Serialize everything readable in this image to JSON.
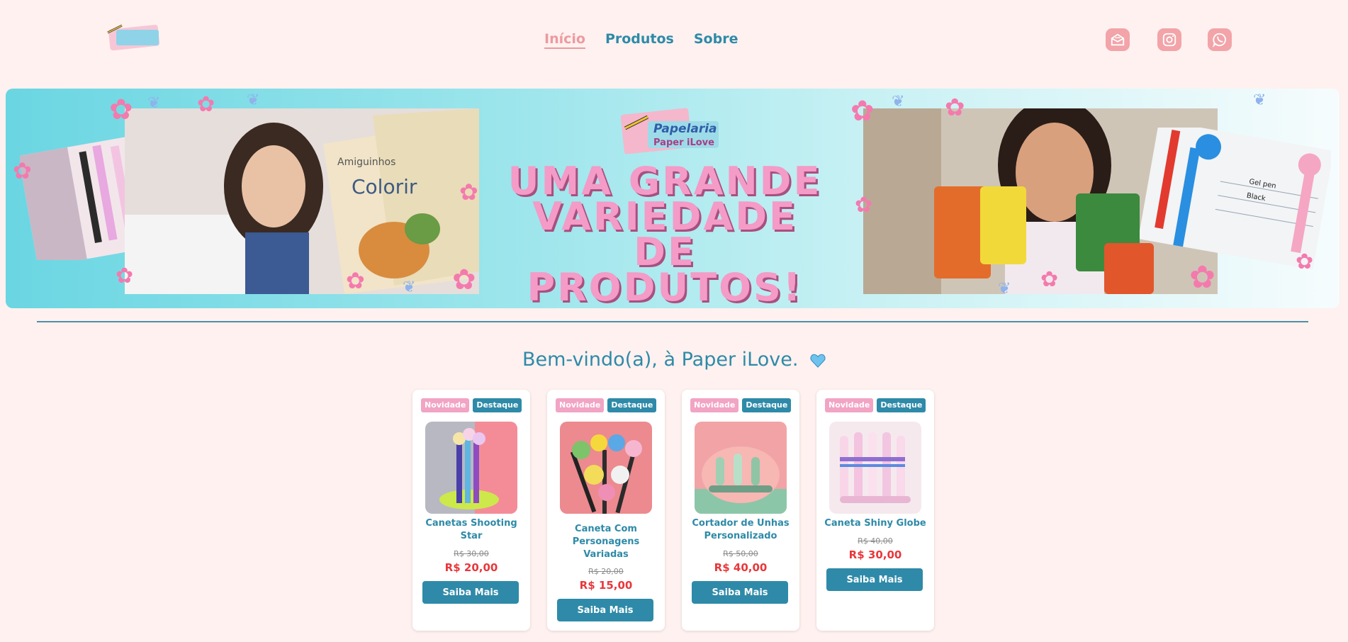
{
  "header": {
    "logo_alt": "Papelaria Paper iLove",
    "nav": [
      {
        "label": "Início",
        "active": true
      },
      {
        "label": "Produtos",
        "active": false
      },
      {
        "label": "Sobre",
        "active": false
      }
    ],
    "social": [
      {
        "icon": "mail-icon"
      },
      {
        "icon": "instagram-icon"
      },
      {
        "icon": "whatsapp-icon"
      }
    ]
  },
  "banner": {
    "logo_line1": "Papelaria",
    "logo_line2": "Paper iLove",
    "title_line1": "UMA GRANDE",
    "title_line2": "VARIEDADE DE",
    "title_line3": "PRODUTOS!",
    "book_text_1": "Amiguinhos",
    "book_text_2": "Colorir",
    "note_text_1": "Gel pen",
    "note_text_2": "Black"
  },
  "welcome": "Bem-vindo(a), à Paper iLove.",
  "colors": {
    "accent": "#2e8aa8",
    "pink": "#f2a4c4",
    "price": "#e8383b",
    "background": "#fff1ef"
  },
  "products": [
    {
      "badge_new": "Novidade",
      "badge_feat": "Destaque",
      "name": "Canetas Shooting Star",
      "old_price": "R$ 30,00",
      "price": "R$ 20,00",
      "button": "Saiba Mais"
    },
    {
      "badge_new": "Novidade",
      "badge_feat": "Destaque",
      "name": "Caneta Com Personagens Variadas",
      "old_price": "R$ 20,00",
      "price": "R$ 15,00",
      "button": "Saiba Mais"
    },
    {
      "badge_new": "Novidade",
      "badge_feat": "Destaque",
      "name": "Cortador de Unhas Personalizado",
      "old_price": "R$ 50,00",
      "price": "R$ 40,00",
      "button": "Saiba Mais"
    },
    {
      "badge_new": "Novidade",
      "badge_feat": "Destaque",
      "name": "Caneta Shiny Globe",
      "old_price": "R$ 40,00",
      "price": "R$ 30,00",
      "button": "Saiba Mais"
    }
  ]
}
